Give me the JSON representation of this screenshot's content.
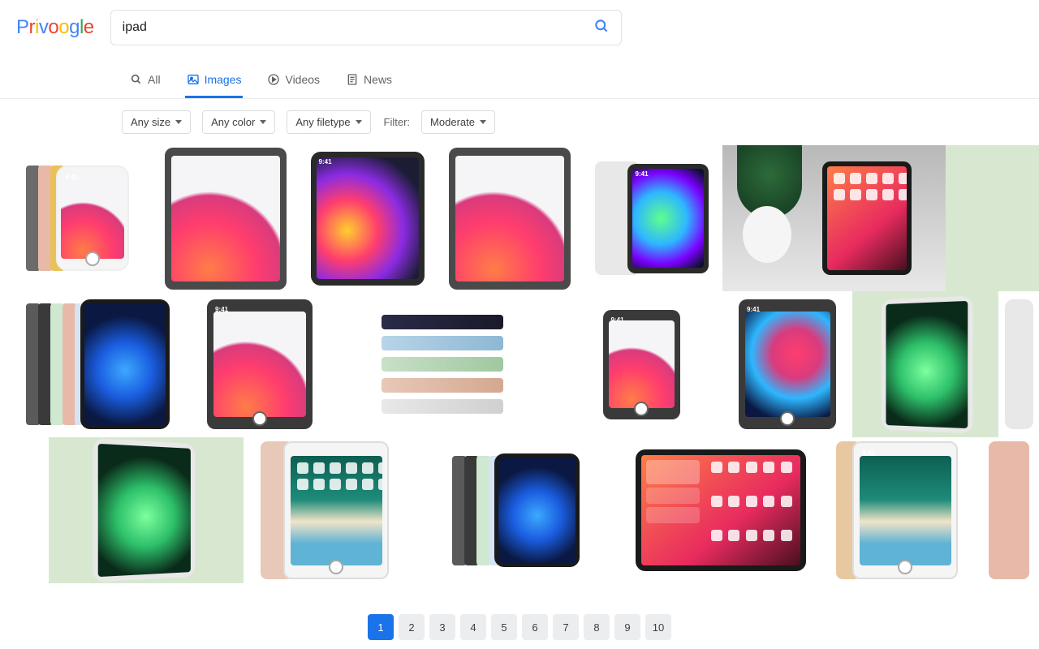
{
  "brand": {
    "p": "P",
    "r": "r",
    "i": "i",
    "v": "v",
    "o1": "o",
    "o2": "o",
    "g": "g",
    "l": "l",
    "e": "e"
  },
  "search": {
    "query": "ipad",
    "placeholder": ""
  },
  "tabs": [
    {
      "id": "all",
      "label": "All",
      "active": false
    },
    {
      "id": "images",
      "label": "Images",
      "active": true
    },
    {
      "id": "videos",
      "label": "Videos",
      "active": false
    },
    {
      "id": "news",
      "label": "News",
      "active": false
    }
  ],
  "filters": {
    "size": "Any size",
    "color": "Any color",
    "filetype": "Any filetype",
    "filter_label": "Filter:",
    "moderate": "Moderate"
  },
  "pagination": {
    "current": 1,
    "pages": [
      1,
      2,
      3,
      4,
      5,
      6,
      7,
      8,
      9,
      10
    ]
  }
}
